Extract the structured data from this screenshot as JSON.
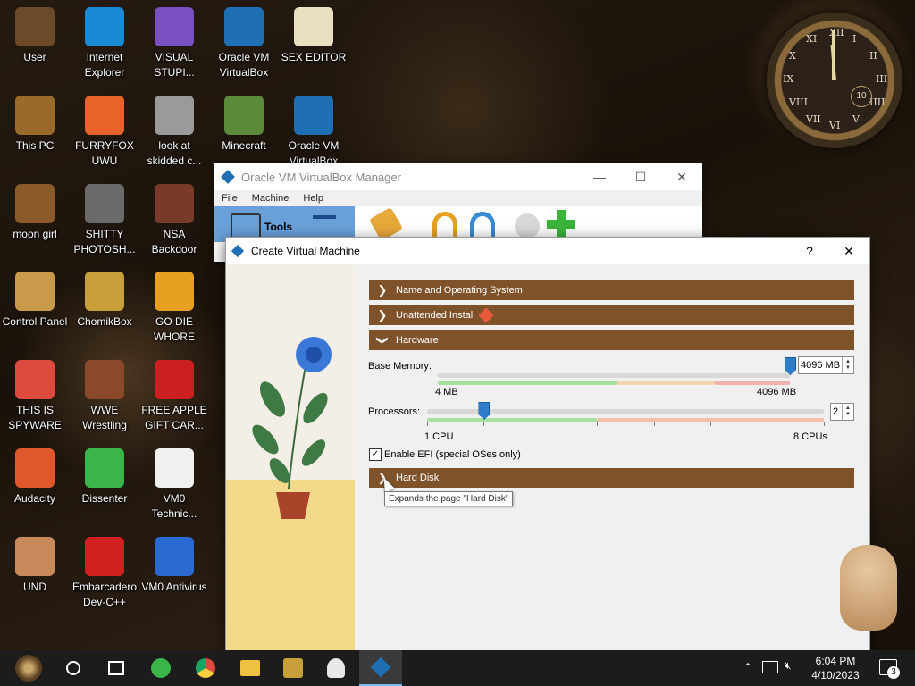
{
  "desktop": {
    "icons": [
      {
        "label": "User",
        "icon": "user-figure-icon",
        "color": "#6b4a2a"
      },
      {
        "label": "Internet Explorer",
        "icon": "edge-browser-icon",
        "color": "#1b8ad6"
      },
      {
        "label": "VISUAL STUPI...",
        "icon": "visual-studio-icon",
        "color": "#7a4fc0"
      },
      {
        "label": "Oracle VM VirtualBox",
        "icon": "virtualbox-icon",
        "color": "#1f6fb5"
      },
      {
        "label": "SEX EDITOR",
        "icon": "hex-editor-icon",
        "color": "#e8e0c0"
      },
      {
        "label": "This PC",
        "icon": "computer-icon",
        "color": "#9a6a2a"
      },
      {
        "label": "FURRYFOX UWU",
        "icon": "firefox-icon",
        "color": "#e8622a"
      },
      {
        "label": "look at skidded c...",
        "icon": "copy-pages-icon",
        "color": "#9a9a9a"
      },
      {
        "label": "Minecraft",
        "icon": "minecraft-icon",
        "color": "#5a8a3a"
      },
      {
        "label": "Oracle VM VirtualBox",
        "icon": "virtualbox-icon",
        "color": "#1f6fb5"
      },
      {
        "label": "moon girl",
        "icon": "folder-icon",
        "color": "#8a5a2a"
      },
      {
        "label": "SHITTY PHOTOSH...",
        "icon": "gimp-icon",
        "color": "#6a6a6a"
      },
      {
        "label": "NSA Backdoor",
        "icon": "steampunk-screen-icon",
        "color": "#7a3a2a"
      },
      {
        "label": "Control Panel",
        "icon": "lightbulb-icon",
        "color": "#c89a4a"
      },
      {
        "label": "ChomikBox",
        "icon": "hamster-box-icon",
        "color": "#c8a03a"
      },
      {
        "label": "GO DIE WHORE",
        "icon": "de-icon",
        "color": "#e8a020"
      },
      {
        "label": "THIS IS SPYWARE",
        "icon": "chrome-icon",
        "color": "#dd4b3e"
      },
      {
        "label": "WWE Wrestling",
        "icon": "tv-icon",
        "color": "#8a4a2a"
      },
      {
        "label": "FREE APPLE GIFT CAR...",
        "icon": "apple-icon",
        "color": "#cc2020"
      },
      {
        "label": "Audacity",
        "icon": "audacity-icon",
        "color": "#e0582a"
      },
      {
        "label": "Dissenter",
        "icon": "dissenter-icon",
        "color": "#3ab54a"
      },
      {
        "label": "VM0 Technic...",
        "icon": "doctor-icon",
        "color": "#f0f0f0"
      },
      {
        "label": "UND",
        "icon": "cartoon-man-icon",
        "color": "#c88a5a"
      },
      {
        "label": "Embarcadero Dev-C++",
        "icon": "devcpp-icon",
        "color": "#d02020"
      },
      {
        "label": "VM0 Antivirus",
        "icon": "shield-icon",
        "color": "#2a6ad0"
      }
    ]
  },
  "clock_widget": {
    "numerals": [
      "XII",
      "I",
      "II",
      "III",
      "IIII",
      "V",
      "VI",
      "VII",
      "VIII",
      "IX",
      "X",
      "XI"
    ],
    "center": "10"
  },
  "vbmanager": {
    "title": "Oracle VM VirtualBox Manager",
    "menu": [
      "File",
      "Machine",
      "Help"
    ],
    "tools_label": "Tools"
  },
  "dialog": {
    "title": "Create Virtual Machine",
    "help": "?",
    "close": "✕",
    "sections": {
      "name_os": "Name and Operating System",
      "unattended": "Unattended Install",
      "hardware": "Hardware",
      "hard_disk": "Hard Disk"
    },
    "base_memory": {
      "label": "Base Memory:",
      "value": "4096 MB",
      "min_label": "4 MB",
      "max_label": "4096 MB",
      "level": 1.0
    },
    "processors": {
      "label": "Processors:",
      "value": "2",
      "min_label": "1 CPU",
      "max_label": "8 CPUs",
      "level": 0.143
    },
    "efi": {
      "label": "Enable EFI (special OSes only)",
      "checked": true
    },
    "tooltip": "Expands the page \"Hard Disk\""
  },
  "taskbar": {
    "time": "6:04 PM",
    "date": "4/10/2023",
    "notifications": "3",
    "items": [
      "steampunk-start-icon",
      "search-circle-icon",
      "task-view-icon",
      "dissenter-icon",
      "chrome-icon",
      "file-explorer-icon",
      "hamster-box-icon",
      "doctor-icon",
      "virtualbox-icon"
    ]
  },
  "colors": {
    "section_bar": "#80522a",
    "slider_thumb": "#2d7dc8",
    "taskbar": "#1c1c1c"
  }
}
